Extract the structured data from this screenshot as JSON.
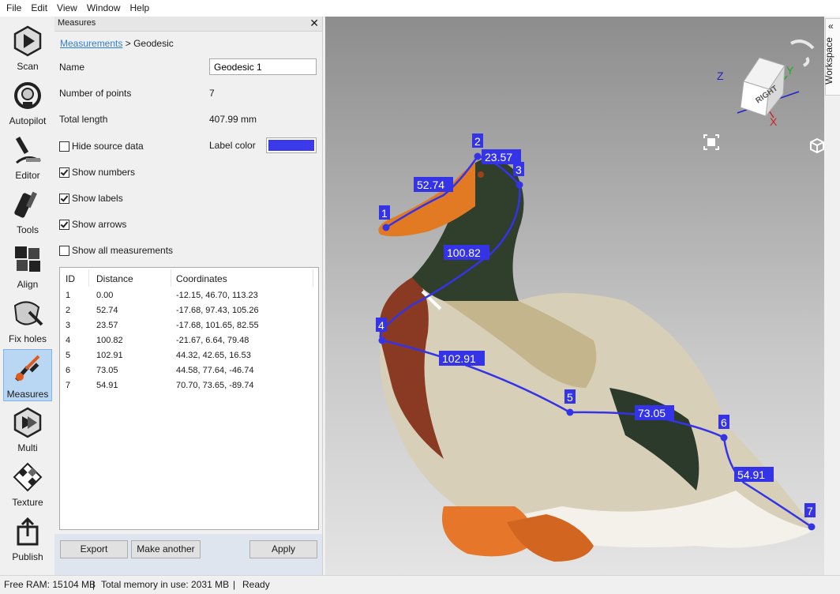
{
  "menu": [
    "File",
    "Edit",
    "View",
    "Window",
    "Help"
  ],
  "tools": [
    {
      "label": "Scan",
      "icon": "scan-icon"
    },
    {
      "label": "Autopilot",
      "icon": "autopilot-icon"
    },
    {
      "label": "Editor",
      "icon": "editor-icon"
    },
    {
      "label": "Tools",
      "icon": "tools-icon"
    },
    {
      "label": "Align",
      "icon": "align-icon"
    },
    {
      "label": "Fix holes",
      "icon": "fix-holes-icon"
    },
    {
      "label": "Measures",
      "icon": "measures-icon",
      "active": true
    },
    {
      "label": "Multi",
      "icon": "multi-icon"
    },
    {
      "label": "Texture",
      "icon": "texture-icon"
    },
    {
      "label": "Publish",
      "icon": "publish-icon"
    }
  ],
  "panel": {
    "title": "Measures",
    "breadcrumb_link": "Measurements",
    "breadcrumb_sep": " > ",
    "breadcrumb_current": "Geodesic",
    "name_label": "Name",
    "name_value": "Geodesic 1",
    "points_label": "Number of points",
    "points_value": "7",
    "length_label": "Total length",
    "length_value": "407.99 mm",
    "hide_source_label": "Hide source data",
    "label_color_label": "Label color",
    "label_color": "#3a3ae8",
    "checkboxes": [
      {
        "label": "Hide source data",
        "checked": false
      },
      {
        "label": "Show numbers",
        "checked": true
      },
      {
        "label": "Show labels",
        "checked": true
      },
      {
        "label": "Show arrows",
        "checked": true
      },
      {
        "label": "Show all measurements",
        "checked": false
      }
    ],
    "table": {
      "headers": [
        "ID",
        "Distance",
        "Coordinates"
      ],
      "rows": [
        [
          "1",
          "0.00",
          "-12.15, 46.70, 113.23"
        ],
        [
          "2",
          "52.74",
          "-17.68, 97.43, 105.26"
        ],
        [
          "3",
          "23.57",
          "-17.68, 101.65, 82.55"
        ],
        [
          "4",
          "100.82",
          "-21.67, 6.64, 79.48"
        ],
        [
          "5",
          "102.91",
          "44.32, 42.65, 16.53"
        ],
        [
          "6",
          "73.05",
          "44.58, 77.64, -46.74"
        ],
        [
          "7",
          "54.91",
          "70.70, 73.65, -89.74"
        ]
      ]
    },
    "buttons": {
      "export": "Export",
      "make_another": "Make another",
      "apply": "Apply"
    }
  },
  "viewport": {
    "points": [
      "1",
      "2",
      "3",
      "4",
      "5",
      "6",
      "7"
    ],
    "segment_labels": [
      "52.74",
      "23.57",
      "100.82",
      "102.91",
      "73.05",
      "54.91"
    ],
    "cube": {
      "face": "RIGHT",
      "axis_x": "X",
      "axis_y": "Y",
      "axis_z": "Z"
    },
    "path_color": "#3434e6"
  },
  "workspace_tab": "Workspace",
  "status": {
    "free_ram": "Free RAM: 15104 MB",
    "memory": "Total memory in use: 2031 MB",
    "state": "Ready",
    "sep": "|"
  }
}
